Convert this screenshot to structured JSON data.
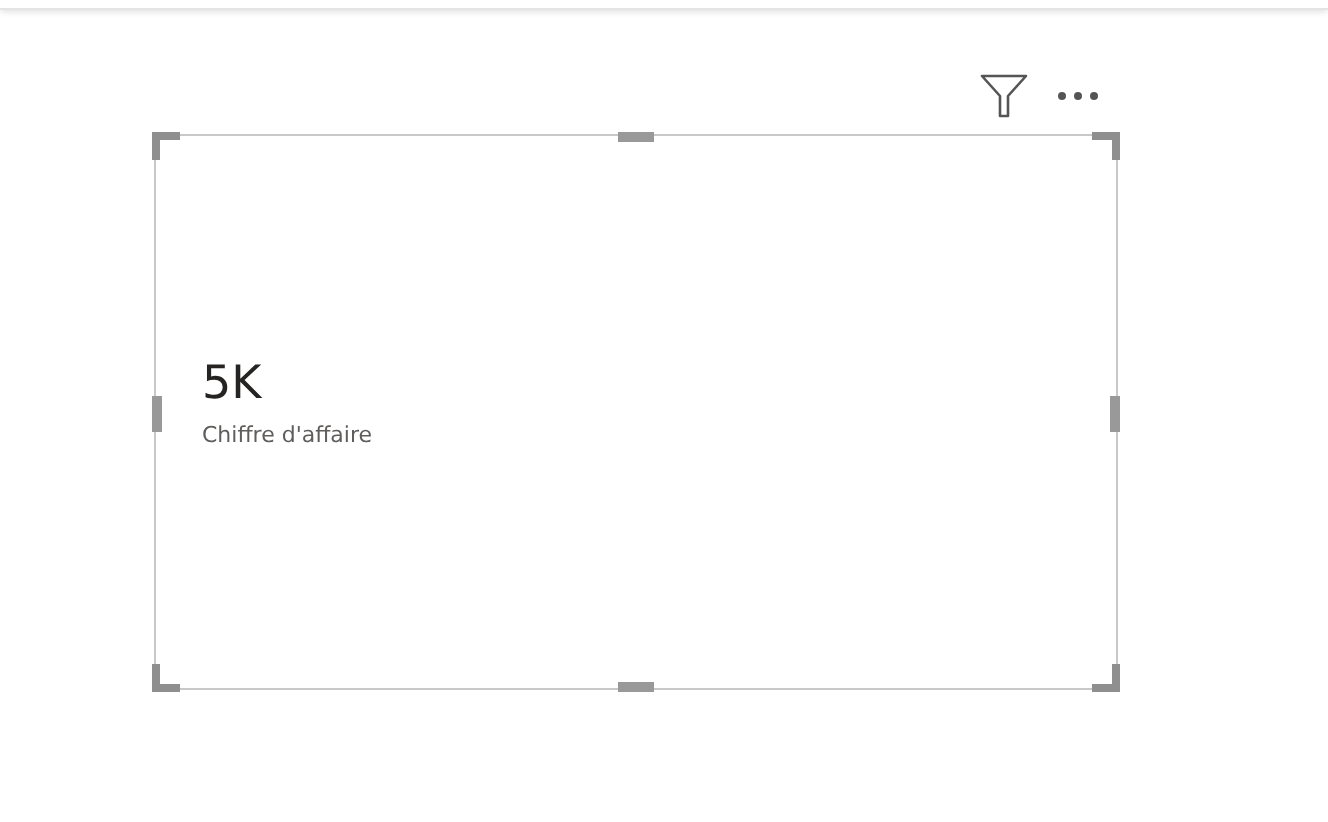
{
  "card": {
    "value": "5K",
    "label": "Chiffre d'affaire"
  }
}
